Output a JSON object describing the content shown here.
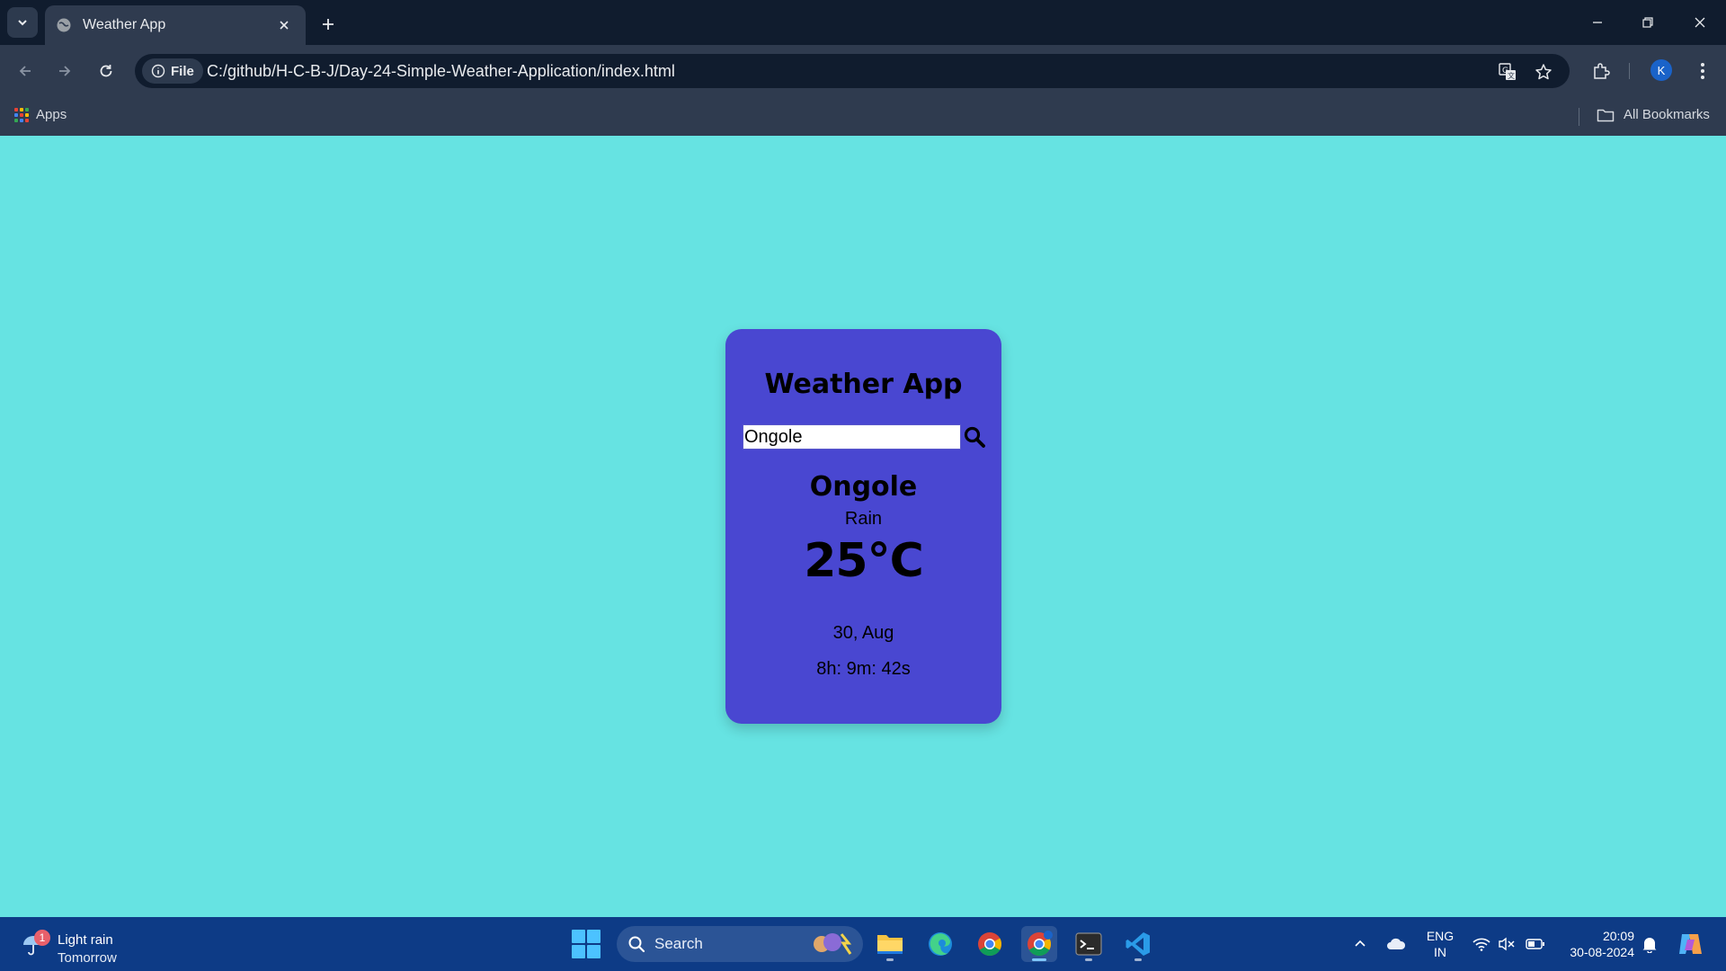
{
  "browser": {
    "tab_title": "Weather App",
    "site_chip_label": "File",
    "url": "C:/github/H-C-B-J/Day-24-Simple-Weather-Application/index.html",
    "profile_initial": "K",
    "bookmarks": {
      "apps_label": "Apps",
      "all_bookmarks_label": "All Bookmarks"
    }
  },
  "weather_app": {
    "title": "Weather App",
    "search": {
      "value": "Ongole"
    },
    "city": "Ongole",
    "condition": "Rain",
    "temperature": "25°C",
    "date": "30, Aug",
    "time": "8h: 9m: 42s"
  },
  "taskbar": {
    "weather": {
      "badge_count": "1",
      "line1": "Light rain",
      "line2": "Tomorrow"
    },
    "search_label": "Search",
    "pinned_apps": [
      "file-explorer",
      "edge",
      "chrome",
      "chrome-profile",
      "terminal",
      "vscode"
    ],
    "language": {
      "line1": "ENG",
      "line2": "IN"
    },
    "clock": {
      "time": "20:09",
      "date": "30-08-2024"
    }
  },
  "colors": {
    "page_background": "#66e3e2",
    "card_background": "#4947d1",
    "browser_dark": "#101c2e",
    "browser_toolbar": "#2f3b4f",
    "taskbar": "#0d3b86"
  }
}
